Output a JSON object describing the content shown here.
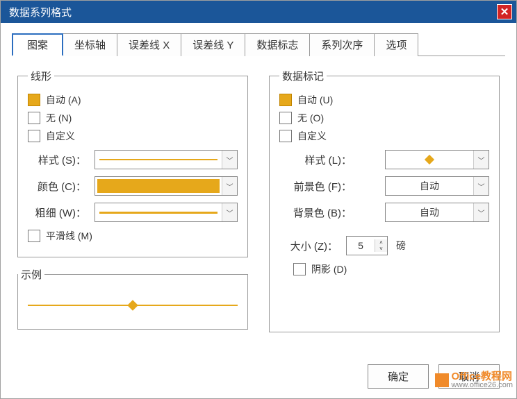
{
  "title": "数据系列格式",
  "tabs": [
    "图案",
    "坐标轴",
    "误差线 X",
    "误差线 Y",
    "数据标志",
    "系列次序",
    "选项"
  ],
  "lineGroup": {
    "legend": "线形",
    "auto": "自动 (A)",
    "none": "无 (N)",
    "custom": "自定义",
    "style": "样式 (S)：",
    "color": "颜色 (C)：",
    "weight": "粗细 (W)：",
    "smooth": "平滑线 (M)"
  },
  "markerGroup": {
    "legend": "数据标记",
    "auto": "自动 (U)",
    "none": "无 (O)",
    "custom": "自定义",
    "style": "样式 (L)：",
    "fg": "前景色 (F)：",
    "bg": "背景色 (B)：",
    "fgVal": "自动",
    "bgVal": "自动",
    "size": "大小 (Z)：",
    "sizeVal": "5",
    "sizeUnit": "磅",
    "shadow": "阴影 (D)"
  },
  "example": {
    "legend": "示例"
  },
  "buttons": {
    "ok": "确定",
    "cancel": "取消"
  },
  "watermark": {
    "brand": "Office教程网",
    "url": "www.office26.com"
  }
}
